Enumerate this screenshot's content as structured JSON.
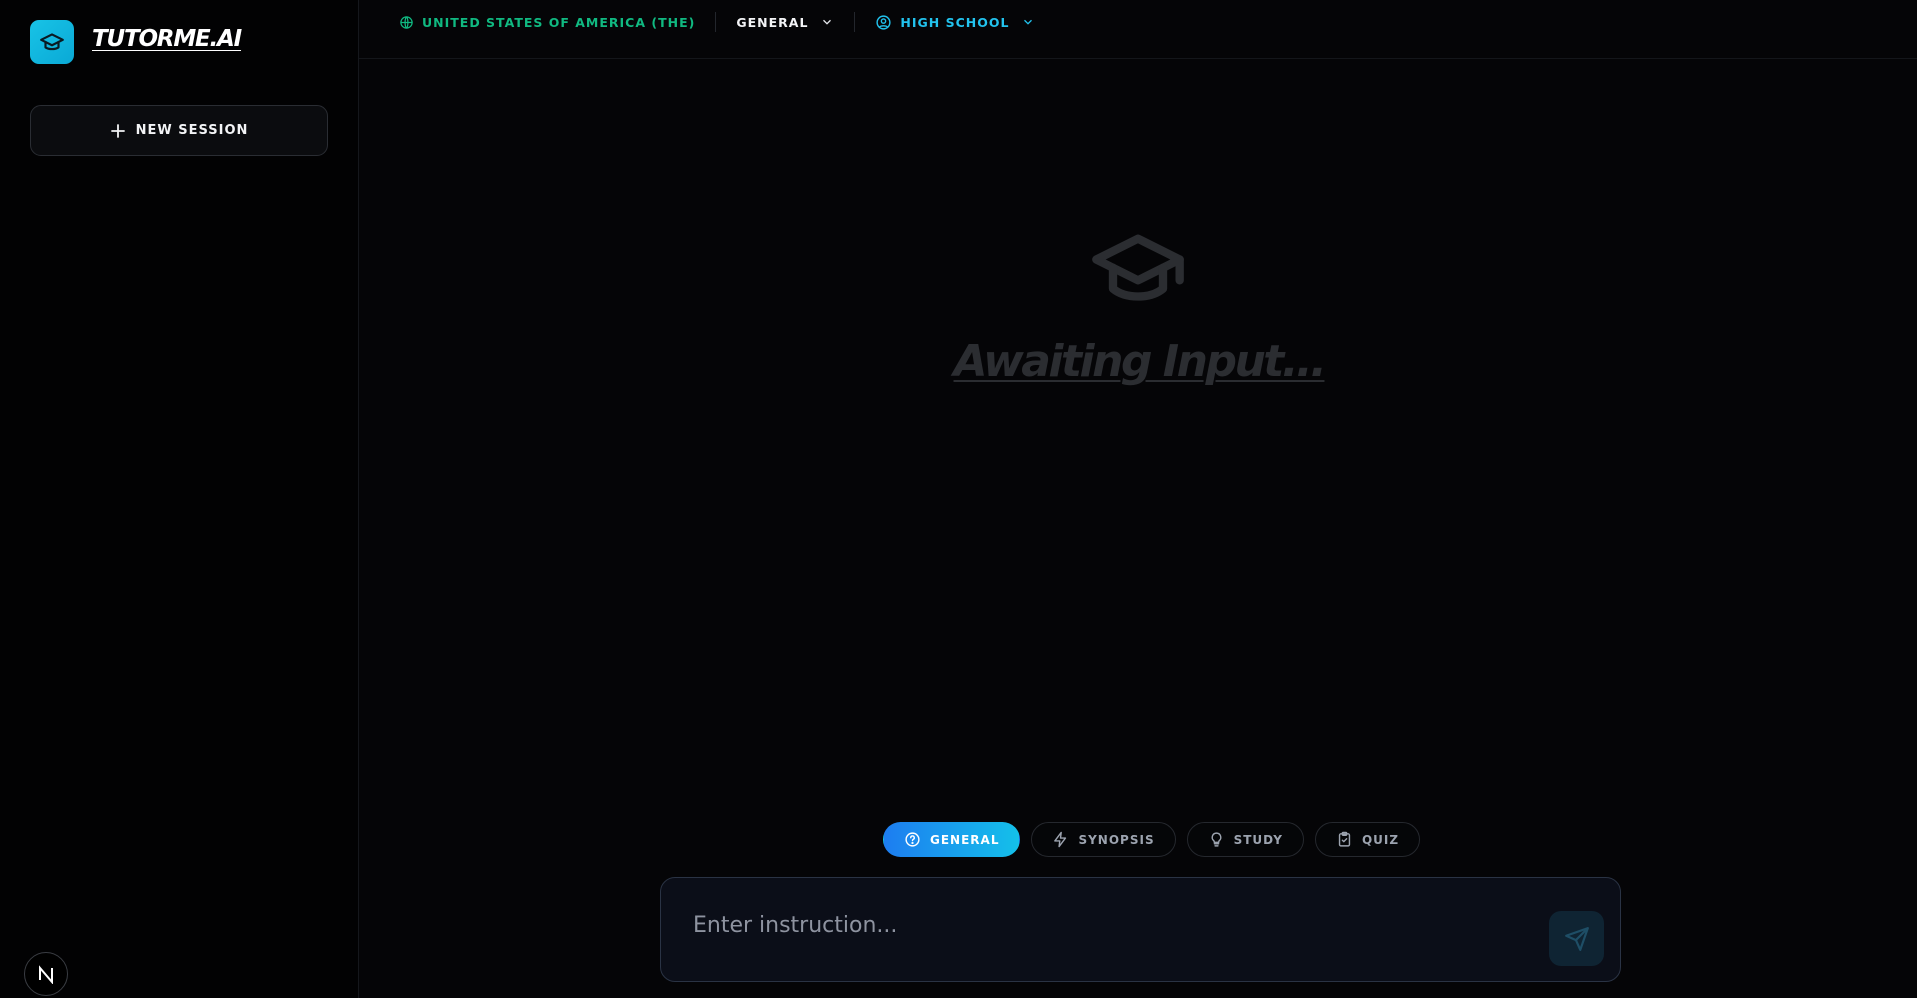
{
  "sidebar": {
    "brand": "TUTORME.AI",
    "new_session_label": "NEW SESSION",
    "badge_letter": "N"
  },
  "topbar": {
    "country": "UNITED STATES OF AMERICA (THE)",
    "subject": "GENERAL",
    "level": "HIGH SCHOOL"
  },
  "main": {
    "empty_text": "Awaiting Input..."
  },
  "modes": [
    {
      "label": "GENERAL",
      "icon": "question-circle-icon",
      "active": true
    },
    {
      "label": "SYNOPSIS",
      "icon": "lightning-icon",
      "active": false
    },
    {
      "label": "STUDY",
      "icon": "lightbulb-icon",
      "active": false
    },
    {
      "label": "QUIZ",
      "icon": "clipboard-check-icon",
      "active": false
    }
  ],
  "composer": {
    "placeholder": "Enter instruction..."
  },
  "colors": {
    "accent": "#14c0ea",
    "country": "#10b981",
    "background": "#050507"
  }
}
